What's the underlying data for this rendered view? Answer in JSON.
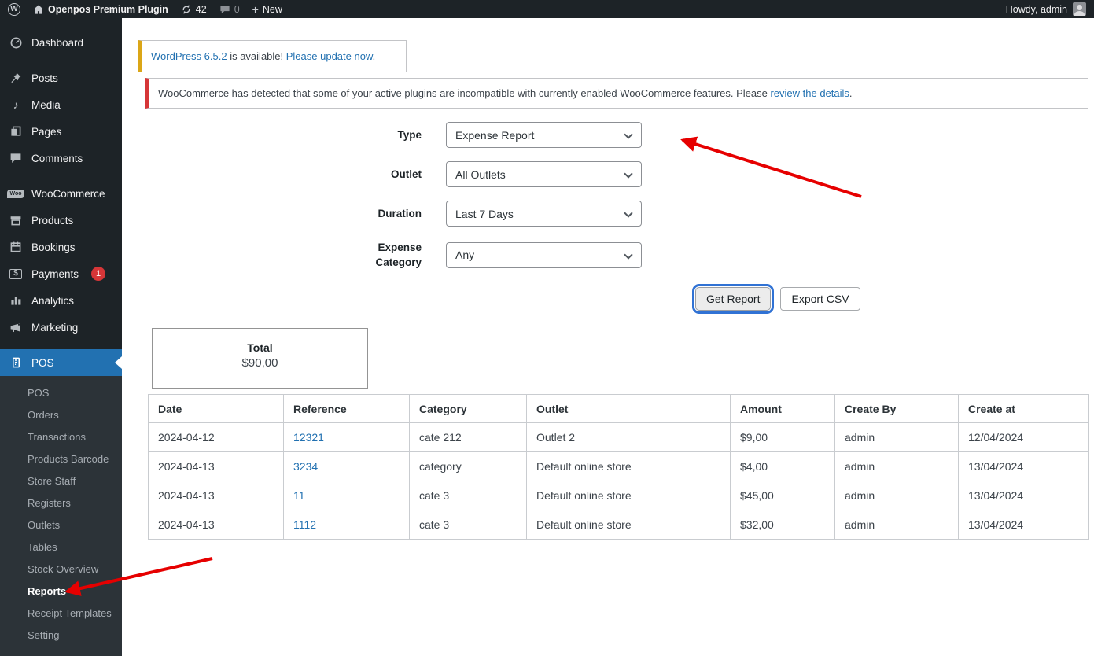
{
  "colors": {
    "admin_bar_bg": "#1d2327",
    "sidebar_bg": "#1d2327",
    "submenu_bg": "#2c3338",
    "active_menu_bg": "#2271b1",
    "link_blue": "#2271b1",
    "badge_red": "#d63638",
    "notice_update_accent": "#dba617",
    "notice_error_accent": "#d63638",
    "annotation_arrow_red": "#e60000",
    "focus_ring_blue": "#3072d4"
  },
  "admin_bar": {
    "site_name": "Openpos Premium Plugin",
    "updates_count": "42",
    "comments_count": "0",
    "new_label": "New",
    "howdy_text": "Howdy, admin"
  },
  "icons": {
    "wp_logo_letter": "W",
    "new_plus": "+",
    "media_note": "♪",
    "woo_label": "Woo",
    "payments_dollar": "$"
  },
  "sidebar": {
    "items": [
      {
        "label": "Dashboard"
      },
      {
        "label": "Posts"
      },
      {
        "label": "Media"
      },
      {
        "label": "Pages"
      },
      {
        "label": "Comments"
      },
      {
        "label": "WooCommerce"
      },
      {
        "label": "Products"
      },
      {
        "label": "Bookings"
      },
      {
        "label": "Payments",
        "badge": "1"
      },
      {
        "label": "Analytics"
      },
      {
        "label": "Marketing"
      },
      {
        "label": "POS",
        "active": true
      }
    ],
    "submenu": [
      {
        "label": "POS"
      },
      {
        "label": "Orders"
      },
      {
        "label": "Transactions"
      },
      {
        "label": "Products Barcode"
      },
      {
        "label": "Store Staff"
      },
      {
        "label": "Registers"
      },
      {
        "label": "Outlets"
      },
      {
        "label": "Tables"
      },
      {
        "label": "Stock Overview"
      },
      {
        "label": "Reports",
        "active": true
      },
      {
        "label": "Receipt Templates"
      },
      {
        "label": "Setting"
      }
    ]
  },
  "notices": {
    "update": {
      "version_link": "WordPress 6.5.2",
      "mid_text": " is available! ",
      "action_link": "Please update now",
      "period": "."
    },
    "woocommerce": {
      "text": "WooCommerce has detected that some of your active plugins are incompatible with currently enabled WooCommerce features. Please ",
      "link": "review the details",
      "period": "."
    }
  },
  "form": {
    "fields": [
      {
        "label": "Type",
        "value": "Expense Report"
      },
      {
        "label": "Outlet",
        "value": "All Outlets"
      },
      {
        "label": "Duration",
        "value": "Last 7 Days"
      },
      {
        "label": "Expense Category",
        "value": "Any"
      }
    ],
    "get_report_label": "Get Report",
    "export_csv_label": "Export CSV"
  },
  "summary": {
    "total_label": "Total",
    "total_value": "$90,00"
  },
  "table": {
    "headers": [
      "Date",
      "Reference",
      "Category",
      "Outlet",
      "Amount",
      "Create By",
      "Create at"
    ],
    "rows": [
      [
        "2024-04-12",
        "12321",
        "cate 212",
        "Outlet 2",
        "$9,00",
        "admin",
        "12/04/2024"
      ],
      [
        "2024-04-13",
        "3234",
        "category",
        "Default online store",
        "$4,00",
        "admin",
        "13/04/2024"
      ],
      [
        "2024-04-13",
        "11",
        "cate 3",
        "Default online store",
        "$45,00",
        "admin",
        "13/04/2024"
      ],
      [
        "2024-04-13",
        "1112",
        "cate 3",
        "Default online store",
        "$32,00",
        "admin",
        "13/04/2024"
      ]
    ]
  }
}
